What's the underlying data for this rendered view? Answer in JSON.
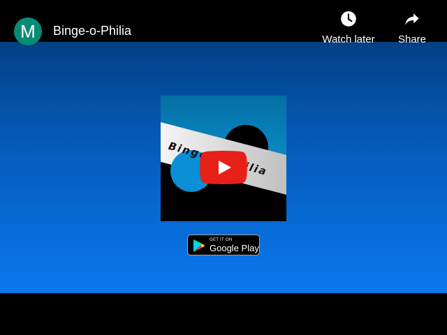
{
  "channel": {
    "avatar_letter": "M",
    "title": "Binge-o-Philia",
    "avatar_color": "#0a8a73"
  },
  "actions": {
    "watch_later": {
      "label": "Watch later",
      "icon": "clock-icon"
    },
    "share": {
      "label": "Share",
      "icon": "share-arrow-icon"
    }
  },
  "thumbnail": {
    "banner_text": "Binge-o-Philia"
  },
  "play_button": {
    "icon": "youtube-play-icon",
    "color": "#e62117"
  },
  "store_badge": {
    "small_text": "GET IT ON",
    "big_text": "Google Play",
    "icon": "google-play-icon"
  },
  "colors": {
    "gradient_top": "#03346c",
    "gradient_bottom": "#0a78ef"
  }
}
